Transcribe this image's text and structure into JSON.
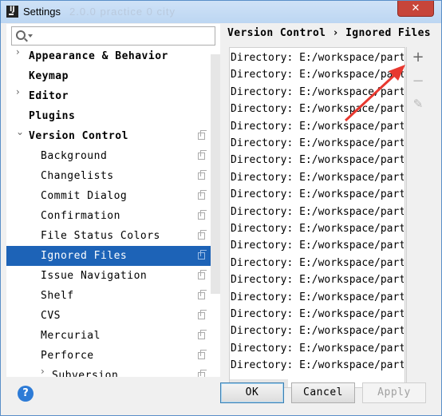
{
  "window": {
    "title": "Settings",
    "title_ghost": "2.0.0 practice 0 city",
    "close_glyph": "✕"
  },
  "search": {
    "placeholder": ""
  },
  "tree": [
    {
      "label": "Appearance & Behavior",
      "bold": true,
      "expander": "›",
      "indent": 0,
      "has_icon": false
    },
    {
      "label": "Keymap",
      "bold": true,
      "expander": "",
      "indent": 0,
      "has_icon": false
    },
    {
      "label": "Editor",
      "bold": true,
      "expander": "›",
      "indent": 0,
      "has_icon": false
    },
    {
      "label": "Plugins",
      "bold": true,
      "expander": "",
      "indent": 0,
      "has_icon": false
    },
    {
      "label": "Version Control",
      "bold": true,
      "expander": "⌄",
      "indent": 0,
      "has_icon": true
    },
    {
      "label": "Background",
      "bold": false,
      "expander": "",
      "indent": 1,
      "has_icon": true
    },
    {
      "label": "Changelists",
      "bold": false,
      "expander": "",
      "indent": 1,
      "has_icon": true
    },
    {
      "label": "Commit Dialog",
      "bold": false,
      "expander": "",
      "indent": 1,
      "has_icon": true
    },
    {
      "label": "Confirmation",
      "bold": false,
      "expander": "",
      "indent": 1,
      "has_icon": true
    },
    {
      "label": "File Status Colors",
      "bold": false,
      "expander": "",
      "indent": 1,
      "has_icon": true
    },
    {
      "label": "Ignored Files",
      "bold": false,
      "expander": "",
      "indent": 1,
      "has_icon": true,
      "selected": true
    },
    {
      "label": "Issue Navigation",
      "bold": false,
      "expander": "",
      "indent": 1,
      "has_icon": true
    },
    {
      "label": "Shelf",
      "bold": false,
      "expander": "",
      "indent": 1,
      "has_icon": true
    },
    {
      "label": "CVS",
      "bold": false,
      "expander": "",
      "indent": 1,
      "has_icon": true
    },
    {
      "label": "Mercurial",
      "bold": false,
      "expander": "",
      "indent": 1,
      "has_icon": true
    },
    {
      "label": "Perforce",
      "bold": false,
      "expander": "",
      "indent": 1,
      "has_icon": true
    },
    {
      "label": "Subversion",
      "bold": false,
      "expander": "›",
      "indent": 1,
      "has_icon": true
    }
  ],
  "breadcrumb": "Version Control › Ignored Files",
  "ignored_list": [
    "Directory: E:/workspace/part",
    "Directory: E:/workspace/part",
    "Directory: E:/workspace/part",
    "Directory: E:/workspace/part",
    "Directory: E:/workspace/part",
    "Directory: E:/workspace/part",
    "Directory: E:/workspace/part",
    "Directory: E:/workspace/part",
    "Directory: E:/workspace/part",
    "Directory: E:/workspace/part",
    "Directory: E:/workspace/part",
    "Directory: E:/workspace/part",
    "Directory: E:/workspace/part",
    "Directory: E:/workspace/part",
    "Directory: E:/workspace/part",
    "Directory: E:/workspace/part",
    "Directory: E:/workspace/part",
    "Directory: E:/workspace/part",
    "Directory: E:/workspace/part"
  ],
  "tools": {
    "add": "+",
    "remove": "−",
    "edit": "✎"
  },
  "buttons": {
    "ok": "OK",
    "cancel": "Cancel",
    "apply": "Apply",
    "help": "?"
  },
  "colors": {
    "selection": "#1d63b7",
    "annotation_arrow": "#e8382f",
    "accent": "#2d7bd6"
  },
  "icons": {
    "search": "search-icon",
    "help": "help-icon",
    "settings": "intellij-icon"
  }
}
